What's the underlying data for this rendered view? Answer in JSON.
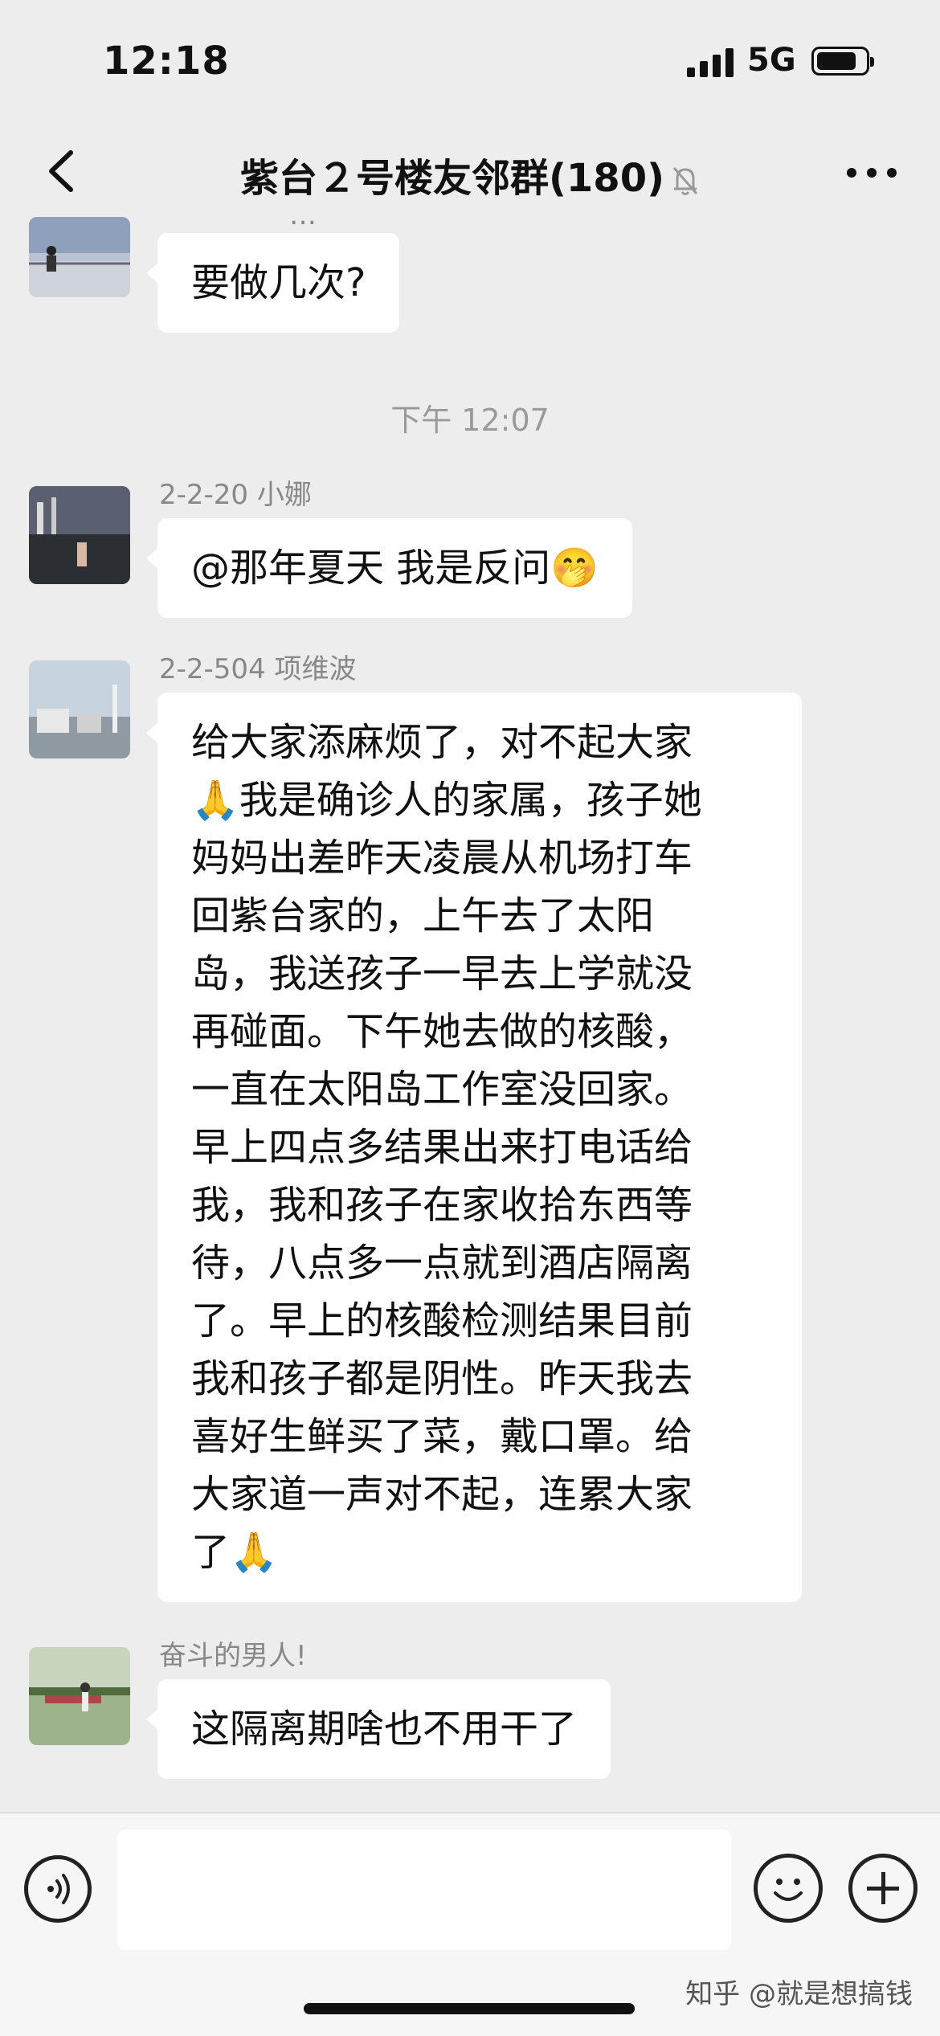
{
  "status_bar": {
    "time": "12:18",
    "network": "5G"
  },
  "header": {
    "title": "紫台２号楼友邻群(180)"
  },
  "messages": [
    {
      "sender_partial": "…",
      "text": "要做几次?"
    },
    {
      "sender": "2-2-20 小娜",
      "text": "@那年夏天 我是反问🤭"
    },
    {
      "sender": "2-2-504 项维波",
      "lines": [
        "给大家添麻烦了，对不起大家",
        "🙏我是确诊人的家属，孩子她",
        "妈妈出差昨天凌晨从机场打车",
        "回紫台家的，上午去了太阳",
        "岛，我送孩子一早去上学就没",
        "再碰面。下午她去做的核酸，",
        "一直在太阳岛工作室没回家。",
        "早上四点多结果出来打电话给",
        "我，我和孩子在家收拾东西等",
        "待，八点多一点就到酒店隔离",
        "了。早上的核酸检测结果目前",
        "我和孩子都是阴性。昨天我去",
        "喜好生鲜买了菜，戴口罩。给",
        "大家道一声对不起，连累大家",
        "了🙏"
      ]
    },
    {
      "sender": "奋斗的男人!",
      "text": "这隔离期啥也不用干了"
    }
  ],
  "timestamp": "下午 12:07",
  "footer": {
    "watermark": "知乎 @就是想搞钱"
  }
}
